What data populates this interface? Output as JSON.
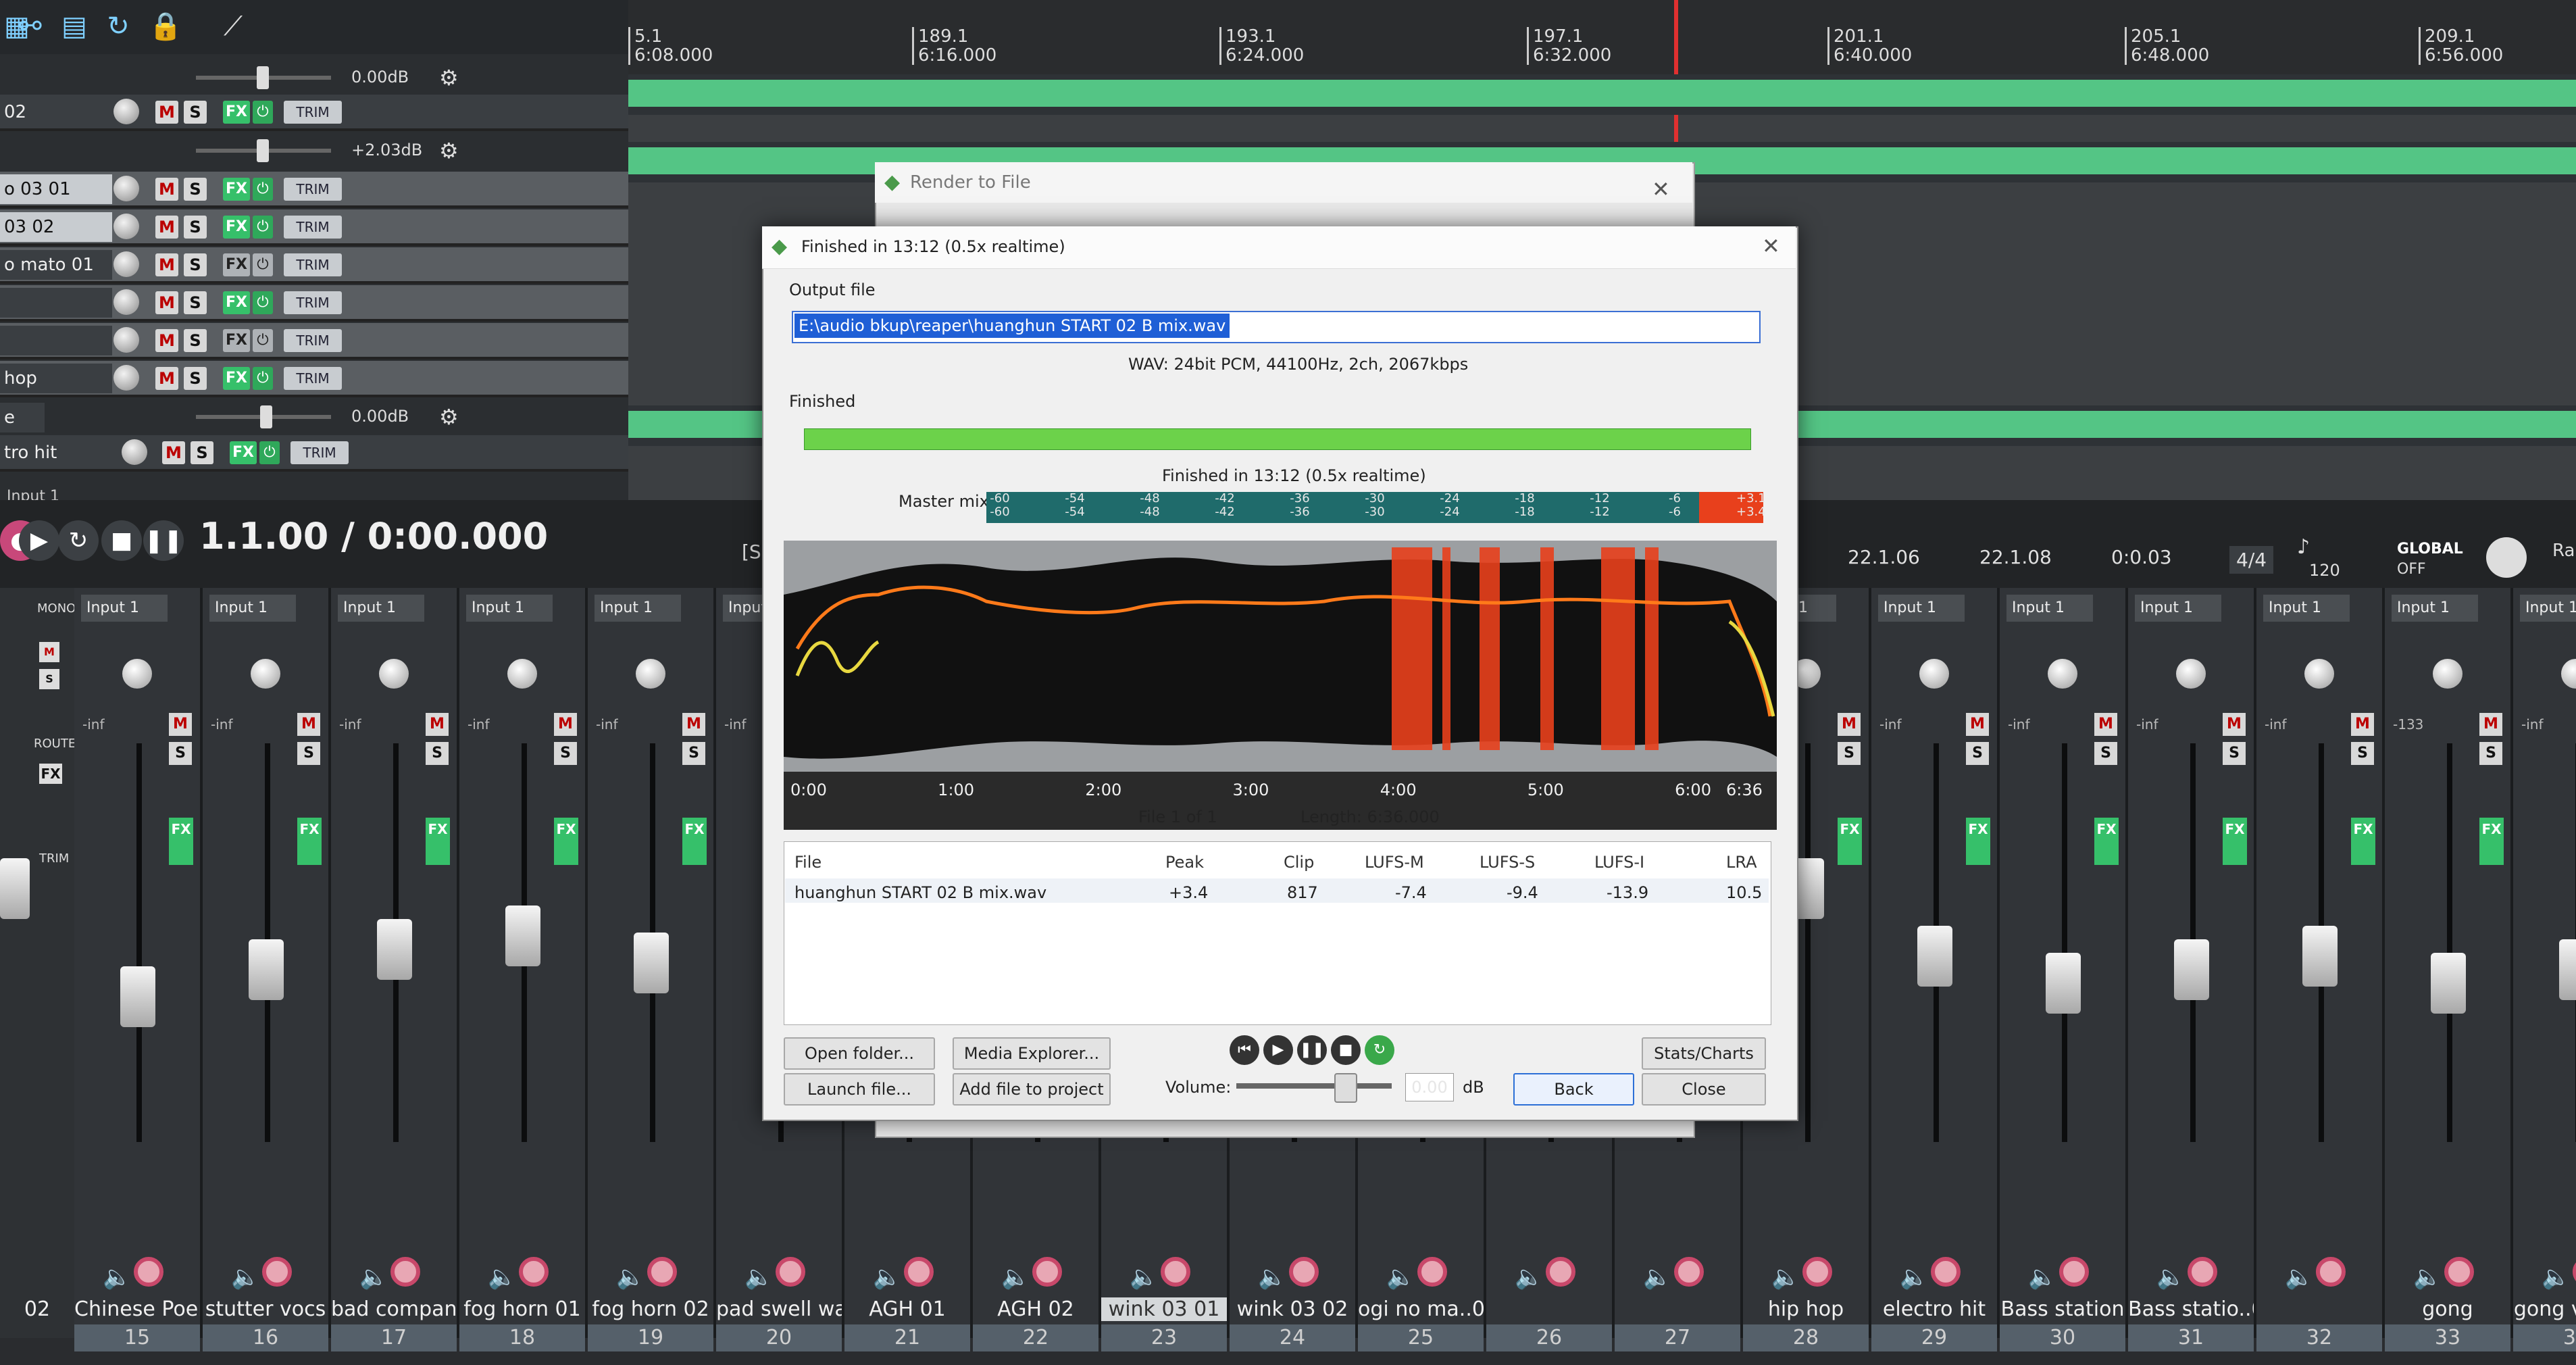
{
  "tcp": {
    "tracks": [
      {
        "name": "",
        "vol": "0.00dB",
        "kind": "vol"
      },
      {
        "name": "02",
        "kind": "track",
        "fx_on": true
      },
      {
        "name": "",
        "vol": "+2.03dB",
        "kind": "vol"
      },
      {
        "name": "o 03 01",
        "kind": "track",
        "fx_on": true,
        "selected": true
      },
      {
        "name": "03 02",
        "kind": "track",
        "fx_on": true
      },
      {
        "name": "o mato 01",
        "kind": "track",
        "fx_on": false
      },
      {
        "name": "",
        "kind": "track",
        "fx_on": true
      },
      {
        "name": "",
        "kind": "track",
        "fx_on": false
      },
      {
        "name": "hop",
        "kind": "track",
        "fx_on": true
      },
      {
        "name": "e",
        "vol": "0.00dB",
        "kind": "vol"
      },
      {
        "name": "tro hit",
        "kind": "track",
        "fx_on": true
      }
    ],
    "button_m": "M",
    "button_s": "S",
    "button_fx": "FX",
    "button_trim": "TRIM",
    "input_label": "Input 1"
  },
  "ruler": [
    {
      "bar": "5.1",
      "time": "6:08.000"
    },
    {
      "bar": "189.1",
      "time": "6:16.000"
    },
    {
      "bar": "193.1",
      "time": "6:24.000"
    },
    {
      "bar": "197.1",
      "time": "6:32.000"
    },
    {
      "bar": "201.1",
      "time": "6:40.000"
    },
    {
      "bar": "205.1",
      "time": "6:48.000"
    },
    {
      "bar": "209.1",
      "time": "6:56.000"
    }
  ],
  "transport": {
    "time": "1.1.00 / 0:00.000",
    "sel_start": "22.1.06",
    "sel_end": "22.1.08",
    "sel_len": "0:0.03",
    "time_sig": "4/4",
    "bpm": "120",
    "global": "GLOBAL",
    "global_state": "OFF",
    "status_fragment": "[S",
    "rate_fragment": "Ra"
  },
  "mixer": {
    "left_buttons": [
      "MONO",
      "M",
      "S",
      "ROUTE",
      "FX",
      "TRIM"
    ],
    "inf": "-inf",
    "strips": [
      {
        "name": "02",
        "num": ""
      },
      {
        "name": "Chinese Poer",
        "num": "15"
      },
      {
        "name": "stutter vocs",
        "num": "16"
      },
      {
        "name": "bad company",
        "num": "17"
      },
      {
        "name": "fog horn 01",
        "num": "18"
      },
      {
        "name": "fog horn 02",
        "num": "19"
      },
      {
        "name": "pad swell wa",
        "num": "20"
      },
      {
        "name": "AGH 01",
        "num": "21"
      },
      {
        "name": "AGH 02",
        "num": "22"
      },
      {
        "name": "wink 03 01",
        "num": "23",
        "selected": true
      },
      {
        "name": "wink 03 02",
        "num": "24"
      },
      {
        "name": "ogi no ma..01",
        "num": "25"
      },
      {
        "name": "",
        "num": "26"
      },
      {
        "name": "",
        "num": "27"
      },
      {
        "name": "hip hop",
        "num": "28"
      },
      {
        "name": "electro hit",
        "num": "29"
      },
      {
        "name": "Bass station",
        "num": "30"
      },
      {
        "name": "Bass statio..02",
        "num": "31"
      },
      {
        "name": "",
        "num": "32"
      },
      {
        "name": "gong",
        "num": "33",
        "peak": "-133"
      },
      {
        "name": "gong vulkan",
        "num": "34"
      }
    ]
  },
  "bg_window": {
    "title": "Render to File"
  },
  "dialog": {
    "title": "Finished in 13:12   (0.5x realtime)",
    "output_label": "Output file",
    "output_path": "E:\\audio bkup\\reaper\\huanghun START 02 B mix.wav",
    "format": "WAV: 24bit PCM, 44100Hz, 2ch, 2067kbps",
    "finished_label": "Finished",
    "progress": 1.0,
    "progress_text": "Finished in 13:12     (0.5x realtime)",
    "master_mix_label": "Master mix",
    "meter_ticks_top": [
      "-60",
      "-54",
      "-48",
      "-42",
      "-36",
      "-30",
      "-24",
      "-18",
      "-12",
      "-6",
      "+3.1"
    ],
    "meter_ticks_bottom": [
      "-60",
      "-54",
      "-48",
      "-42",
      "-36",
      "-30",
      "-24",
      "-18",
      "-12",
      "-6",
      "+3.4"
    ],
    "time_ticks": [
      "0:00",
      "1:00",
      "2:00",
      "3:00",
      "4:00",
      "5:00",
      "6:00",
      "6:36"
    ],
    "file_count": "File 1 of 1",
    "length": "Length: 6:36.000",
    "table_headers": [
      "File",
      "Peak",
      "Clip",
      "LUFS-M",
      "LUFS-S",
      "LUFS-I",
      "LRA"
    ],
    "table_row": [
      "huanghun START 02 B mix.wav",
      "+3.4",
      "817",
      "-7.4",
      "-9.4",
      "-13.9",
      "10.5"
    ],
    "buttons": {
      "open_folder": "Open folder...",
      "media_explorer": "Media Explorer...",
      "launch_file": "Launch file...",
      "add_to_project": "Add file to project",
      "stats_charts": "Stats/Charts",
      "back": "Back",
      "close": "Close"
    },
    "volume_label": "Volume:",
    "volume_value": "0.00",
    "volume_unit": "dB"
  },
  "colors": {
    "accent_green": "#54c585",
    "selection_blue": "#1f5fd6",
    "loudness_orange": "#ff7a1a",
    "loudness_yellow": "#e8d840",
    "clip_red": "#e8401c"
  }
}
